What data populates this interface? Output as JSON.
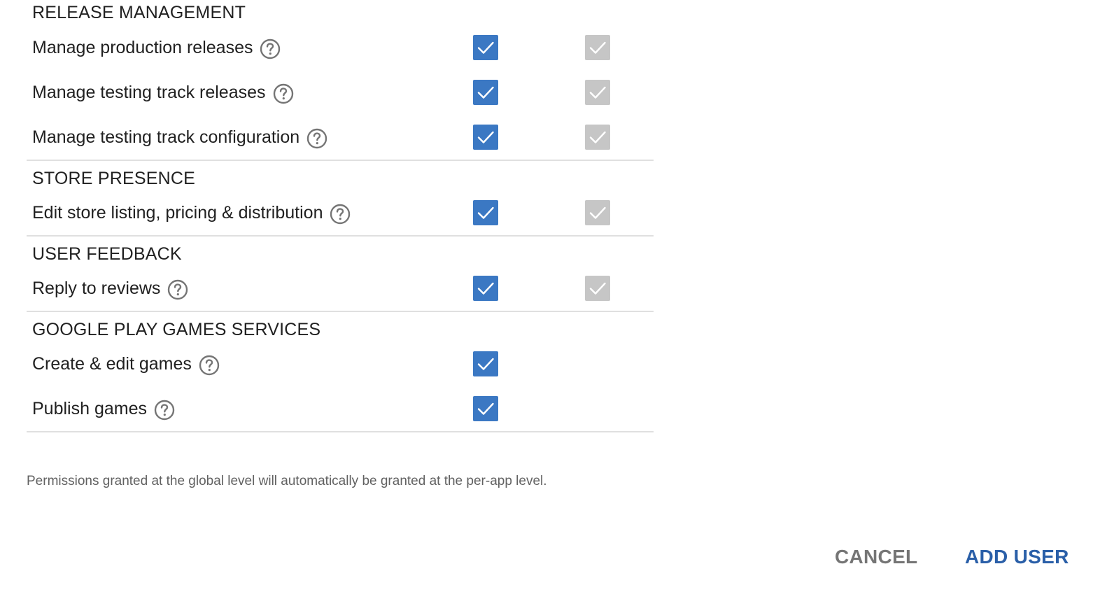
{
  "sections": [
    {
      "title": "RELEASE MANAGEMENT",
      "rows": [
        {
          "label": "Manage production releases",
          "global": true,
          "per_app": true
        },
        {
          "label": "Manage testing track releases",
          "global": true,
          "per_app": true
        },
        {
          "label": "Manage testing track configuration",
          "global": true,
          "per_app": true
        }
      ]
    },
    {
      "title": "STORE PRESENCE",
      "rows": [
        {
          "label": "Edit store listing, pricing & distribution",
          "global": true,
          "per_app": true
        }
      ]
    },
    {
      "title": "USER FEEDBACK",
      "rows": [
        {
          "label": "Reply to reviews",
          "global": true,
          "per_app": true
        }
      ]
    },
    {
      "title": "GOOGLE PLAY GAMES SERVICES",
      "rows": [
        {
          "label": "Create & edit games",
          "global": true,
          "per_app": null
        },
        {
          "label": "Publish games",
          "global": true,
          "per_app": null
        }
      ]
    }
  ],
  "footnote": "Permissions granted at the global level will automatically be granted at the per-app level.",
  "actions": {
    "cancel_label": "CANCEL",
    "add_user_label": "ADD USER"
  },
  "colors": {
    "checkbox_checked": "#3b78c3",
    "checkbox_inherited": "#c6c6c6",
    "primary_button": "#2a5fa8",
    "secondary_button": "#757575"
  },
  "icons": {
    "help": "help-circle-icon",
    "check": "check-icon"
  }
}
